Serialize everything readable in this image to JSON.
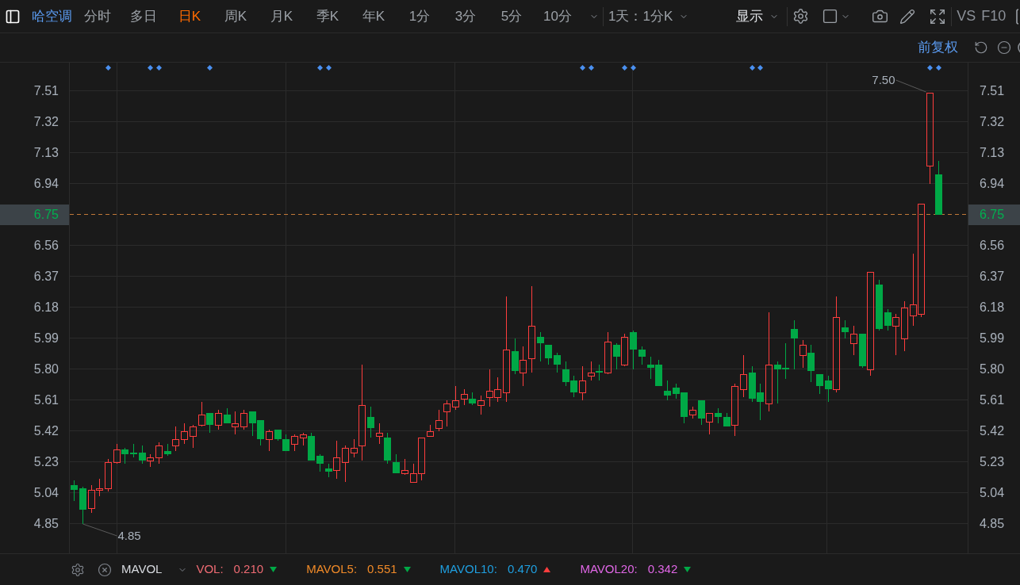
{
  "toolbar": {
    "stock_name": "哈空调",
    "periods": [
      {
        "label": "分时",
        "selected": false
      },
      {
        "label": "多日",
        "selected": false
      },
      {
        "label": "日K",
        "selected": true
      },
      {
        "label": "周K",
        "selected": false
      },
      {
        "label": "月K",
        "selected": false
      },
      {
        "label": "季K",
        "selected": false
      },
      {
        "label": "年K",
        "selected": false
      },
      {
        "label": "1分",
        "selected": false
      },
      {
        "label": "3分",
        "selected": false
      },
      {
        "label": "5分",
        "selected": false
      },
      {
        "label": "10分",
        "selected": false
      }
    ],
    "range": "1天：1分K",
    "display": "显示",
    "compare": "VS",
    "f10": "F10"
  },
  "options": {
    "adjustment": "前复权"
  },
  "chart": {
    "right_axis": {
      "labels": [
        "7.51",
        "7.32",
        "7.13",
        "6.94",
        "6.56",
        "6.37",
        "6.18",
        "5.99",
        "5.80",
        "5.61",
        "5.42",
        "5.23",
        "5.04",
        "4.85"
      ],
      "current": "6.75"
    },
    "chart_data": {
      "type": "candlestick",
      "grid": true,
      "categories": [
        null,
        null,
        null,
        null,
        null,
        null,
        null,
        null,
        null,
        null,
        null,
        null,
        null,
        null,
        null,
        null,
        null,
        null,
        null,
        null,
        null,
        null,
        null,
        null,
        null,
        null,
        null,
        null,
        null,
        null,
        null,
        null,
        null,
        null,
        null,
        null,
        null,
        null,
        null,
        null,
        null,
        null,
        null,
        null,
        null,
        null,
        null,
        null,
        null,
        null,
        null,
        null,
        null,
        null,
        null,
        null,
        null,
        null,
        null,
        null,
        null,
        null,
        null,
        null,
        null,
        null,
        null,
        null,
        null,
        null,
        null,
        null,
        null,
        null,
        null,
        null,
        null,
        null,
        null,
        null,
        null,
        null,
        null,
        null,
        null,
        null,
        null,
        null,
        null,
        null,
        null,
        null,
        null,
        null,
        null,
        null,
        null,
        null,
        null,
        null,
        null,
        null,
        null,
        null,
        null,
        null
      ],
      "ylim": [
        4.67,
        7.685
      ],
      "yticks": [
        {
          "value": 7.51,
          "label": "7.51"
        },
        {
          "value": 7.32,
          "label": "7.32"
        },
        {
          "value": 7.13,
          "label": "7.13"
        },
        {
          "value": 6.94,
          "label": "6.94"
        },
        {
          "value": 6.56,
          "label": "6.56"
        },
        {
          "value": 6.37,
          "label": "6.37"
        },
        {
          "value": 6.18,
          "label": "6.18"
        },
        {
          "value": 5.99,
          "label": "5.99"
        },
        {
          "value": 5.8,
          "label": "5.80"
        },
        {
          "value": 5.61,
          "label": "5.61"
        },
        {
          "value": 5.42,
          "label": "5.42"
        },
        {
          "value": 5.23,
          "label": "5.23"
        },
        {
          "value": 5.04,
          "label": "5.04"
        },
        {
          "value": 4.85,
          "label": "4.85"
        }
      ],
      "ref_lines": [
        {
          "axis": "y",
          "value": 6.75,
          "label": "6.75"
        }
      ],
      "annotations": [
        "7.50",
        "4.85"
      ],
      "ohlc": [
        [
          5.09,
          5.12,
          4.99,
          5.06
        ],
        [
          5.07,
          5.08,
          4.85,
          4.94
        ],
        [
          4.95,
          5.09,
          4.92,
          5.06
        ],
        [
          5.06,
          5.13,
          5.02,
          5.07
        ],
        [
          5.07,
          5.25,
          5.05,
          5.23
        ],
        [
          5.23,
          5.34,
          5.22,
          5.31
        ],
        [
          5.31,
          5.32,
          5.22,
          5.28
        ],
        [
          5.29,
          5.34,
          5.26,
          5.28
        ],
        [
          5.29,
          5.33,
          5.22,
          5.24
        ],
        [
          5.24,
          5.28,
          5.2,
          5.26
        ],
        [
          5.26,
          5.35,
          5.22,
          5.33
        ],
        [
          5.3,
          5.34,
          5.27,
          5.28
        ],
        [
          5.33,
          5.45,
          5.3,
          5.37
        ],
        [
          5.37,
          5.47,
          5.34,
          5.42
        ],
        [
          5.39,
          5.46,
          5.32,
          5.45
        ],
        [
          5.46,
          5.6,
          5.45,
          5.52
        ],
        [
          5.53,
          5.53,
          5.41,
          5.46
        ],
        [
          5.46,
          5.55,
          5.43,
          5.53
        ],
        [
          5.52,
          5.56,
          5.47,
          5.47
        ],
        [
          5.45,
          5.54,
          5.4,
          5.47
        ],
        [
          5.45,
          5.55,
          5.43,
          5.53
        ],
        [
          5.54,
          5.54,
          5.39,
          5.47
        ],
        [
          5.49,
          5.49,
          5.33,
          5.37
        ],
        [
          5.37,
          5.43,
          5.3,
          5.42
        ],
        [
          5.43,
          5.43,
          5.36,
          5.37
        ],
        [
          5.37,
          5.4,
          5.3,
          5.3
        ],
        [
          5.34,
          5.4,
          5.3,
          5.39
        ],
        [
          5.38,
          5.41,
          5.33,
          5.4
        ],
        [
          5.39,
          5.41,
          5.24,
          5.24
        ],
        [
          5.27,
          5.28,
          5.17,
          5.22
        ],
        [
          5.19,
          5.22,
          5.14,
          5.17
        ],
        [
          5.18,
          5.36,
          5.13,
          5.26
        ],
        [
          5.23,
          5.33,
          5.11,
          5.32
        ],
        [
          5.29,
          5.37,
          5.26,
          5.32
        ],
        [
          5.33,
          5.83,
          5.24,
          5.58
        ],
        [
          5.51,
          5.57,
          5.38,
          5.44
        ],
        [
          5.39,
          5.47,
          5.34,
          5.41
        ],
        [
          5.38,
          5.41,
          5.22,
          5.24
        ],
        [
          5.23,
          5.28,
          5.16,
          5.16
        ],
        [
          5.16,
          5.25,
          5.15,
          5.18
        ],
        [
          5.11,
          5.22,
          5.11,
          5.16
        ],
        [
          5.16,
          5.38,
          5.12,
          5.38
        ],
        [
          5.39,
          5.46,
          5.39,
          5.42
        ],
        [
          5.44,
          5.55,
          5.42,
          5.49
        ],
        [
          5.54,
          5.61,
          5.45,
          5.59
        ],
        [
          5.57,
          5.7,
          5.55,
          5.61
        ],
        [
          5.62,
          5.68,
          5.58,
          5.65
        ],
        [
          5.62,
          5.66,
          5.58,
          5.59
        ],
        [
          5.58,
          5.64,
          5.52,
          5.61
        ],
        [
          5.63,
          5.8,
          5.57,
          5.67
        ],
        [
          5.63,
          5.75,
          5.6,
          5.68
        ],
        [
          5.66,
          6.25,
          5.6,
          5.92
        ],
        [
          5.91,
          5.99,
          5.77,
          5.79
        ],
        [
          5.78,
          5.94,
          5.7,
          5.86
        ],
        [
          5.87,
          6.31,
          5.78,
          6.07
        ],
        [
          6.0,
          6.03,
          5.85,
          5.96
        ],
        [
          5.95,
          5.95,
          5.83,
          5.87
        ],
        [
          5.89,
          5.9,
          5.78,
          5.83
        ],
        [
          5.8,
          5.85,
          5.7,
          5.72
        ],
        [
          5.73,
          5.76,
          5.63,
          5.66
        ],
        [
          5.66,
          5.82,
          5.61,
          5.73
        ],
        [
          5.76,
          5.85,
          5.73,
          5.78
        ],
        [
          5.79,
          5.83,
          5.73,
          5.78
        ],
        [
          5.78,
          6.03,
          5.77,
          5.97
        ],
        [
          5.95,
          5.96,
          5.8,
          5.88
        ],
        [
          5.83,
          6.02,
          5.82,
          6.0
        ],
        [
          6.03,
          6.04,
          5.8,
          5.92
        ],
        [
          5.92,
          5.94,
          5.83,
          5.88
        ],
        [
          5.83,
          5.88,
          5.74,
          5.81
        ],
        [
          5.83,
          5.86,
          5.7,
          5.7
        ],
        [
          5.67,
          5.73,
          5.61,
          5.64
        ],
        [
          5.69,
          5.71,
          5.62,
          5.65
        ],
        [
          5.66,
          5.66,
          5.47,
          5.51
        ],
        [
          5.52,
          5.57,
          5.5,
          5.55
        ],
        [
          5.61,
          5.61,
          5.46,
          5.5
        ],
        [
          5.48,
          5.53,
          5.4,
          5.53
        ],
        [
          5.53,
          5.56,
          5.47,
          5.51
        ],
        [
          5.51,
          5.53,
          5.45,
          5.45
        ],
        [
          5.46,
          5.71,
          5.39,
          5.7
        ],
        [
          5.68,
          5.89,
          5.63,
          5.77
        ],
        [
          5.78,
          5.82,
          5.6,
          5.62
        ],
        [
          5.66,
          5.71,
          5.49,
          5.6
        ],
        [
          5.59,
          6.15,
          5.54,
          5.83
        ],
        [
          5.83,
          5.85,
          5.59,
          5.8
        ],
        [
          5.81,
          5.96,
          5.74,
          5.8
        ],
        [
          6.05,
          6.1,
          5.8,
          5.99
        ],
        [
          5.89,
          5.98,
          5.81,
          5.95
        ],
        [
          5.9,
          5.95,
          5.72,
          5.79
        ],
        [
          5.77,
          5.77,
          5.65,
          5.7
        ],
        [
          5.73,
          5.76,
          5.6,
          5.68
        ],
        [
          5.68,
          6.25,
          5.66,
          6.12
        ],
        [
          6.06,
          6.1,
          5.99,
          6.03
        ],
        [
          5.96,
          6.07,
          5.89,
          6.02
        ],
        [
          6.02,
          6.02,
          5.81,
          5.82
        ],
        [
          5.8,
          6.4,
          5.76,
          6.4
        ],
        [
          6.32,
          6.35,
          6.04,
          6.05
        ],
        [
          6.15,
          6.17,
          6.04,
          6.07
        ],
        [
          6.07,
          6.14,
          5.89,
          6.12
        ],
        [
          5.99,
          6.22,
          5.91,
          6.18
        ],
        [
          6.13,
          6.51,
          6.07,
          6.2
        ],
        [
          6.14,
          6.82,
          6.12,
          6.82
        ],
        [
          7.05,
          7.5,
          6.94,
          7.5
        ],
        [
          7.0,
          7.08,
          6.75,
          6.75
        ],
        null,
        null,
        null
      ]
    }
  },
  "indicator_bar": {
    "name": "MAVOL",
    "items": [
      {
        "label": "VOL:",
        "value": "0.210",
        "up": false,
        "color": "#ef6b73"
      },
      {
        "label": "MAVOL5:",
        "value": "0.551",
        "up": false,
        "color": "#f08a28"
      },
      {
        "label": "MAVOL10:",
        "value": "0.470",
        "up": true,
        "color": "#1f9fe0"
      },
      {
        "label": "MAVOL20:",
        "value": "0.342",
        "up": false,
        "color": "#e067e6"
      }
    ]
  }
}
